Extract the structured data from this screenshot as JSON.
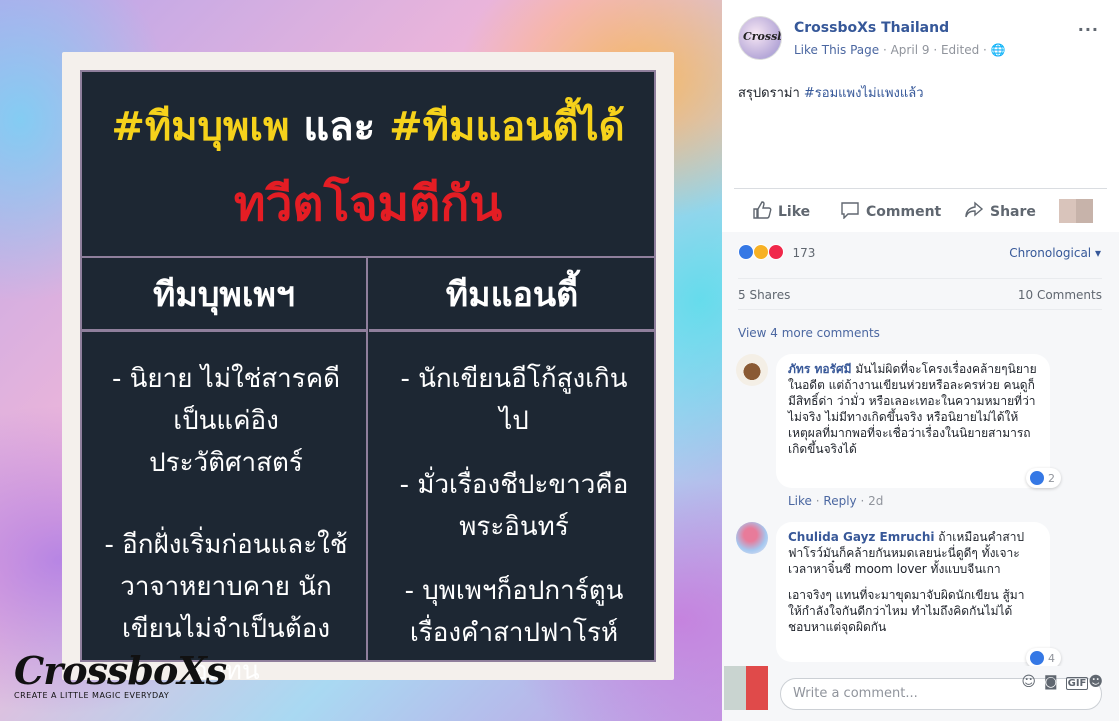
{
  "photo": {
    "headline_left": "#ทีมบุพเพ",
    "headline_mid": "และ",
    "headline_right": "#ทีมแอนตี้ได้",
    "headline_sub": "ทวีตโจมตีกัน",
    "columns": [
      {
        "title": "ทีมบุพเพฯ",
        "items": [
          "- นิยาย ไม่ใช่สารคดี เป็นแค่อิงประวัติศาสตร์",
          "- อีกฝั่งเริ่มก่อนและใช้วาจาหยาบคาย นักเขียนไม่จำเป็นต้องอดทน"
        ]
      },
      {
        "title": "ทีมแอนตี้",
        "items": [
          "- นักเขียนอีโก้สูงเกินไป",
          "- มั่วเรื่องชีปะขาวคือพระอินทร์",
          "- บุพเพฯก็อปการ์ตูนเรื่องคำสาปฟาโรห์"
        ]
      }
    ],
    "brand_name": "CrossboXs",
    "brand_tagline": "CREATE A LITTLE MAGIC EVERYDAY"
  },
  "post": {
    "page_avatar_text": "CrossboXs",
    "page_name": "CrossboXs Thailand",
    "like_page": "Like This Page",
    "date": "April 9",
    "edited": "Edited",
    "more_icon": "···",
    "text_plain": "สรุปดราม่า ",
    "text_hashtag": "#รอมแพงไม่แพงแล้ว"
  },
  "actions": {
    "like": "Like",
    "comment": "Comment",
    "share": "Share"
  },
  "stats": {
    "reaction_count": "173",
    "sort_label": "Chronological",
    "shares": "5 Shares",
    "comments": "10 Comments",
    "view_more": "View 4 more comments"
  },
  "comments": [
    {
      "name": "ภัทร ทอรัศมี",
      "text": " มันไม่ผิดที่จะโครงเรื่องคล้ายๆนิยายในอดีต แต่ถ้างานเขียนห่วยหรือละครห่วย คนดูก็มีสิทธิ์ด่า ว่ามั่ว หรือเลอะเทอะในความหมายที่ว่าไม่จริง ไม่มีทางเกิดขึ้นจริง หรือนิยายไม่ได้ให้เหตุผลที่มากพอที่จะเชื่อว่าเรื่องในนิยายสามารถเกิดขึ้นจริงได้",
      "reactions": "2",
      "like": "Like",
      "reply": "Reply",
      "age": "2d"
    },
    {
      "name": "Chulida Gayz Emruchi",
      "text": " ถ้าเหมือนคำสาปฟาโรว์มันก็คล้ายกันหมดเลยน่ะนี่ดูดีๆ ทั้งเจาะเวลาหาจิ๋นซี moom lover ทั้งแบบจีนเกา",
      "text2": "เอาจริงๆ แทนที่จะมาขุดมาจับผิดนักเขียน สู้มาให้กำลังใจกันดีกว่าไหม ทำไมถึงคิดกันไม่ได้ ชอบหาแต่จุดผิดกัน",
      "reactions": "4"
    }
  ],
  "composer": {
    "placeholder": "Write a comment...",
    "icons": [
      "smiley-icon",
      "camera-icon",
      "gif-icon",
      "sticker-icon"
    ]
  },
  "colors": {
    "facebook_blue": "#365899",
    "headline_yellow": "#f6d21b",
    "headline_red": "#e41d24",
    "card_bg": "#1d2733"
  }
}
